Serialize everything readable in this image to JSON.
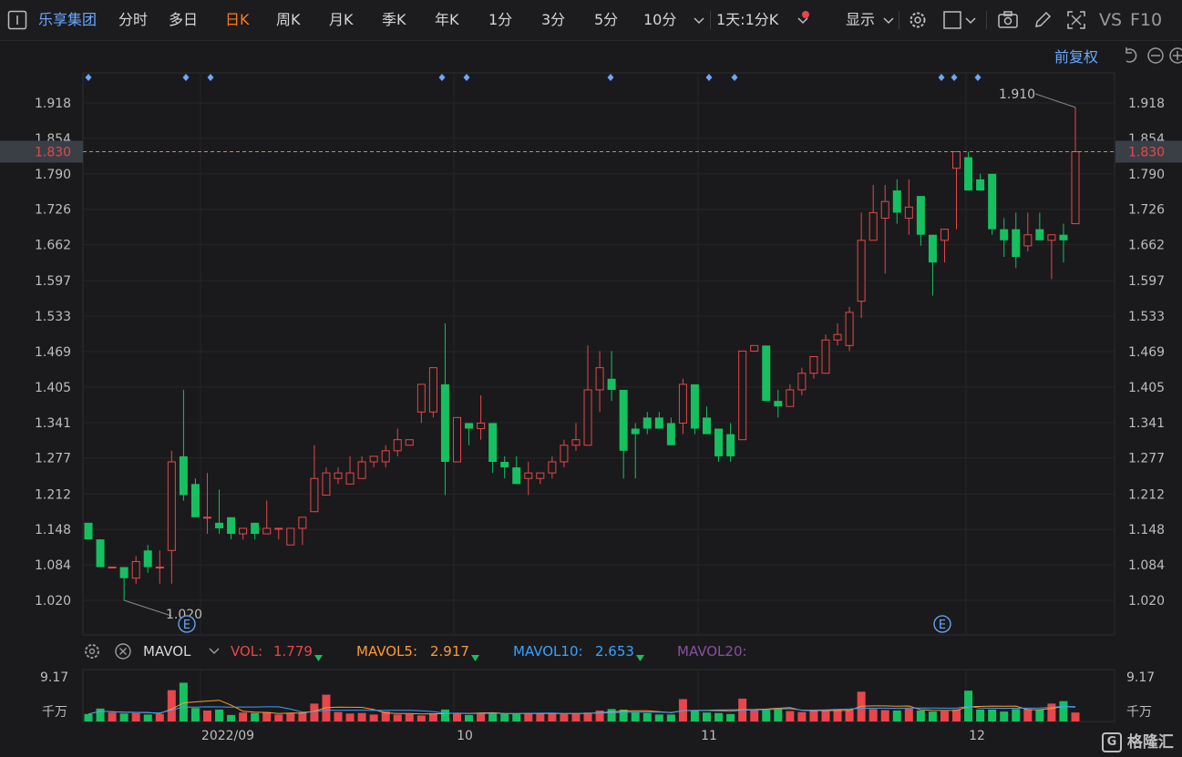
{
  "toolbar": {
    "stock_name": "乐享集团",
    "periods": [
      "分时",
      "多日",
      "日K",
      "周K",
      "月K",
      "季K",
      "年K",
      "1分",
      "3分",
      "5分",
      "10分"
    ],
    "active_period": "日K",
    "interval": "1天:1分K",
    "display": "显示",
    "vs": "VS",
    "f10": "F10"
  },
  "price_panel": {
    "adjust_label": "前复权",
    "current_price": "1.830",
    "high_label": "1.910",
    "low_label": "1.020",
    "event_marker": "E",
    "y_ticks": [
      "1.918",
      "1.854",
      "1.790",
      "1.726",
      "1.662",
      "1.597",
      "1.533",
      "1.469",
      "1.405",
      "1.341",
      "1.277",
      "1.212",
      "1.148",
      "1.084",
      "1.020"
    ]
  },
  "indicator": {
    "name": "MAVOL",
    "vol_label": "VOL:",
    "vol_value": "1.779",
    "mavol5_label": "MAVOL5:",
    "mavol5_value": "2.917",
    "mavol10_label": "MAVOL10:",
    "mavol10_value": "2.653",
    "mavol20_label": "MAVOL20:",
    "max_label": "9.17",
    "unit_label": "千万"
  },
  "x_labels": [
    "2022/09",
    "10",
    "11",
    "12"
  ],
  "watermark": "格隆汇",
  "colors": {
    "up": "#e8464a",
    "down": "#16c060",
    "accent": "#ff7a1a",
    "blue": "#6aa8ff",
    "mavol5": "#ff9a2e",
    "mavol10": "#3aa0ff",
    "mavol20": "#8a4fa0"
  },
  "chart_data": {
    "type": "candlestick",
    "ylim": [
      0.98,
      1.96
    ],
    "candles": [
      [
        1.16,
        1.16,
        1.13,
        1.13
      ],
      [
        1.13,
        1.13,
        1.08,
        1.08
      ],
      [
        1.08,
        1.08,
        1.08,
        1.08
      ],
      [
        1.08,
        1.08,
        1.02,
        1.06
      ],
      [
        1.06,
        1.1,
        1.05,
        1.09
      ],
      [
        1.11,
        1.12,
        1.07,
        1.08
      ],
      [
        1.08,
        1.11,
        1.05,
        1.08
      ],
      [
        1.11,
        1.29,
        1.05,
        1.27
      ],
      [
        1.28,
        1.4,
        1.2,
        1.21
      ],
      [
        1.23,
        1.24,
        1.17,
        1.17
      ],
      [
        1.17,
        1.25,
        1.14,
        1.17
      ],
      [
        1.16,
        1.22,
        1.14,
        1.15
      ],
      [
        1.17,
        1.17,
        1.13,
        1.14
      ],
      [
        1.14,
        1.15,
        1.13,
        1.15
      ],
      [
        1.16,
        1.16,
        1.13,
        1.14
      ],
      [
        1.14,
        1.2,
        1.14,
        1.15
      ],
      [
        1.15,
        1.15,
        1.13,
        1.15
      ],
      [
        1.12,
        1.15,
        1.12,
        1.15
      ],
      [
        1.15,
        1.17,
        1.12,
        1.17
      ],
      [
        1.18,
        1.3,
        1.18,
        1.24
      ],
      [
        1.21,
        1.26,
        1.21,
        1.25
      ],
      [
        1.24,
        1.26,
        1.23,
        1.25
      ],
      [
        1.23,
        1.28,
        1.23,
        1.25
      ],
      [
        1.24,
        1.28,
        1.24,
        1.27
      ],
      [
        1.27,
        1.28,
        1.26,
        1.28
      ],
      [
        1.27,
        1.3,
        1.26,
        1.29
      ],
      [
        1.29,
        1.33,
        1.28,
        1.31
      ],
      [
        1.3,
        1.31,
        1.3,
        1.31
      ],
      [
        1.36,
        1.41,
        1.34,
        1.41
      ],
      [
        1.36,
        1.44,
        1.35,
        1.44
      ],
      [
        1.41,
        1.52,
        1.21,
        1.27
      ],
      [
        1.27,
        1.35,
        1.27,
        1.35
      ],
      [
        1.34,
        1.34,
        1.3,
        1.33
      ],
      [
        1.33,
        1.39,
        1.31,
        1.34
      ],
      [
        1.34,
        1.34,
        1.25,
        1.27
      ],
      [
        1.27,
        1.28,
        1.24,
        1.26
      ],
      [
        1.26,
        1.28,
        1.23,
        1.23
      ],
      [
        1.24,
        1.27,
        1.21,
        1.25
      ],
      [
        1.24,
        1.25,
        1.23,
        1.25
      ],
      [
        1.25,
        1.28,
        1.24,
        1.27
      ],
      [
        1.27,
        1.31,
        1.26,
        1.3
      ],
      [
        1.3,
        1.34,
        1.29,
        1.31
      ],
      [
        1.3,
        1.48,
        1.3,
        1.4
      ],
      [
        1.4,
        1.47,
        1.36,
        1.44
      ],
      [
        1.42,
        1.47,
        1.38,
        1.4
      ],
      [
        1.4,
        1.4,
        1.24,
        1.29
      ],
      [
        1.33,
        1.34,
        1.24,
        1.32
      ],
      [
        1.35,
        1.36,
        1.32,
        1.33
      ],
      [
        1.35,
        1.36,
        1.33,
        1.33
      ],
      [
        1.34,
        1.35,
        1.3,
        1.3
      ],
      [
        1.34,
        1.42,
        1.32,
        1.41
      ],
      [
        1.41,
        1.41,
        1.32,
        1.33
      ],
      [
        1.35,
        1.37,
        1.32,
        1.32
      ],
      [
        1.33,
        1.33,
        1.27,
        1.28
      ],
      [
        1.32,
        1.34,
        1.27,
        1.28
      ],
      [
        1.31,
        1.47,
        1.31,
        1.47
      ],
      [
        1.47,
        1.48,
        1.47,
        1.48
      ],
      [
        1.48,
        1.48,
        1.38,
        1.38
      ],
      [
        1.38,
        1.4,
        1.35,
        1.37
      ],
      [
        1.37,
        1.41,
        1.37,
        1.4
      ],
      [
        1.4,
        1.44,
        1.39,
        1.43
      ],
      [
        1.43,
        1.46,
        1.42,
        1.46
      ],
      [
        1.43,
        1.5,
        1.43,
        1.49
      ],
      [
        1.49,
        1.52,
        1.48,
        1.5
      ],
      [
        1.48,
        1.55,
        1.47,
        1.54
      ],
      [
        1.56,
        1.72,
        1.53,
        1.67
      ],
      [
        1.67,
        1.77,
        1.67,
        1.72
      ],
      [
        1.71,
        1.77,
        1.61,
        1.74
      ],
      [
        1.76,
        1.78,
        1.7,
        1.72
      ],
      [
        1.71,
        1.78,
        1.68,
        1.73
      ],
      [
        1.75,
        1.75,
        1.66,
        1.68
      ],
      [
        1.68,
        1.68,
        1.57,
        1.63
      ],
      [
        1.67,
        1.67,
        1.63,
        1.69
      ],
      [
        1.8,
        1.83,
        1.69,
        1.83
      ],
      [
        1.82,
        1.83,
        1.76,
        1.76
      ],
      [
        1.78,
        1.79,
        1.76,
        1.76
      ],
      [
        1.79,
        1.79,
        1.68,
        1.69
      ],
      [
        1.69,
        1.71,
        1.64,
        1.67
      ],
      [
        1.69,
        1.72,
        1.62,
        1.64
      ],
      [
        1.66,
        1.72,
        1.65,
        1.68
      ],
      [
        1.69,
        1.72,
        1.68,
        1.67
      ],
      [
        1.67,
        1.68,
        1.6,
        1.68
      ],
      [
        1.68,
        1.7,
        1.63,
        1.67
      ],
      [
        1.7,
        1.91,
        1.7,
        1.83
      ]
    ],
    "volumes": [
      1.5,
      2.6,
      1.8,
      1.6,
      1.7,
      1.4,
      1.5,
      6.3,
      7.8,
      2.7,
      2.2,
      2.4,
      1.3,
      1.8,
      1.7,
      1.9,
      1.4,
      1.7,
      1.8,
      3.6,
      5.4,
      1.9,
      1.6,
      1.7,
      1.4,
      2.0,
      1.4,
      1.5,
      1.2,
      1.6,
      2.4,
      1.6,
      1.3,
      1.7,
      1.8,
      1.6,
      1.5,
      1.6,
      1.6,
      1.7,
      1.5,
      1.6,
      1.8,
      2.2,
      2.5,
      2.4,
      1.9,
      1.7,
      1.4,
      1.4,
      4.5,
      2.2,
      1.8,
      1.7,
      1.5,
      4.6,
      2.4,
      2.3,
      2.5,
      2.1,
      1.9,
      2.2,
      2.3,
      2.5,
      2.4,
      6.0,
      2.5,
      2.3,
      2.2,
      2.6,
      2.2,
      2.0,
      2.1,
      2.4,
      6.2,
      2.4,
      2.4,
      2.0,
      2.5,
      2.5,
      2.4,
      3.6,
      4.1,
      1.8
    ]
  }
}
